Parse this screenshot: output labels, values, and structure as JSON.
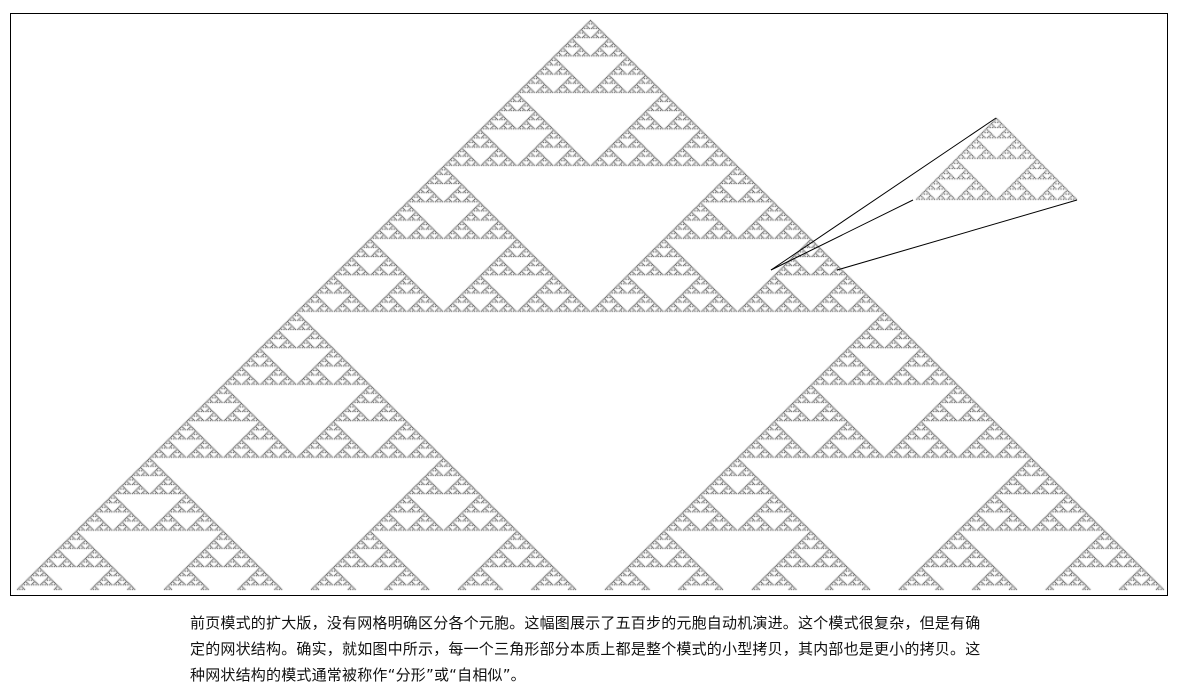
{
  "figure": {
    "rule": 90,
    "steps": 500,
    "cell_color": "#000000",
    "background_color": "#ffffff",
    "inset_description_color": "#000000"
  },
  "caption": {
    "line1": "前页模式的扩大版，没有网格明确区分各个元胞。这幅图展示了五百步的元胞自动机演进。这个模式很复杂，但是有确",
    "line2": "定的网状结构。确实，就如图中所示，每一个三角形部分本质上都是整个模式的小型拷贝，其内部也是更小的拷贝。这",
    "line3": "种网状结构的模式通常被称作“分形”或“自相似”。"
  }
}
